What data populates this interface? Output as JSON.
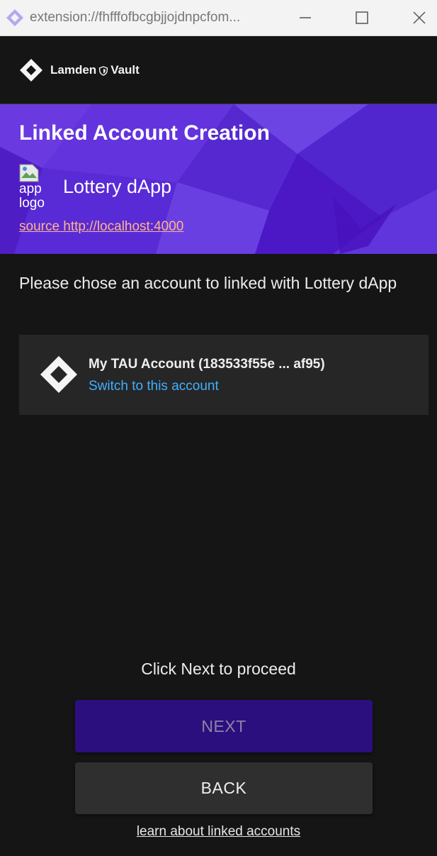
{
  "window": {
    "url": "extension://fhfffofbcgbjjojdnpcfom...",
    "buttons": {
      "minimize": "minimize",
      "maximize": "maximize",
      "close": "close"
    }
  },
  "header": {
    "brand_left": "Lamden",
    "brand_right": "Vault"
  },
  "hero": {
    "title": "Linked Account Creation",
    "app_logo_alt": "app logo",
    "app_name": "Lottery dApp",
    "source_link": "source http://localhost:4000"
  },
  "instructions": "Please chose an account to linked with Lottery dApp",
  "account": {
    "name": "My TAU Account (183533f55e ... af95)",
    "action": "Switch to this account"
  },
  "footer": {
    "proceed_text": "Click Next to proceed",
    "next_label": "NEXT",
    "back_label": "BACK",
    "learn_link": "learn about linked accounts"
  },
  "colors": {
    "hero_bg": "#5b22d2",
    "background": "#151515",
    "link_blue": "#3fb0ff",
    "source_link": "#ffb58a",
    "next_button": "#2c0f7e",
    "back_button": "#2f2f2f"
  },
  "icons": [
    "lamden-extension-icon",
    "lamden-logo-icon",
    "shield-icon",
    "broken-image-icon",
    "account-diamond-icon",
    "minimize-icon",
    "maximize-icon",
    "close-icon"
  ]
}
